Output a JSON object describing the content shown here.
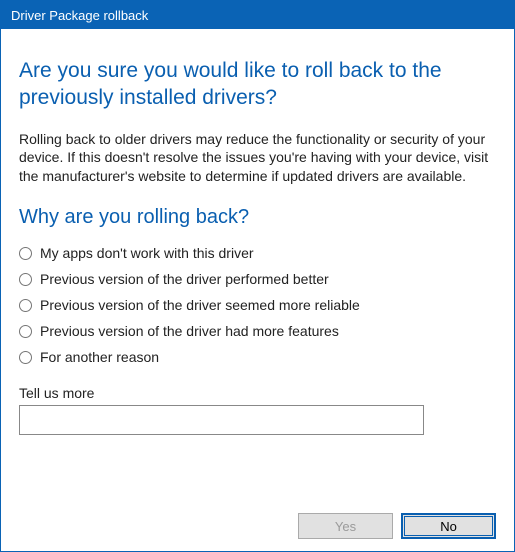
{
  "titlebar": {
    "title": "Driver Package rollback"
  },
  "heading": "Are you sure you would like to roll back to the previously installed drivers?",
  "body": "Rolling back to older drivers may reduce the functionality or security of your device.  If this doesn't resolve the issues you're having with your device, visit the manufacturer's website to determine if updated drivers are available.",
  "subheading": "Why are you rolling back?",
  "options": [
    {
      "label": "My apps don't work with this driver"
    },
    {
      "label": "Previous version of the driver performed better"
    },
    {
      "label": "Previous version of the driver seemed more reliable"
    },
    {
      "label": "Previous version of the driver had more features"
    },
    {
      "label": "For another reason"
    }
  ],
  "tellus": {
    "label": "Tell us more",
    "value": ""
  },
  "buttons": {
    "yes": "Yes",
    "no": "No"
  }
}
